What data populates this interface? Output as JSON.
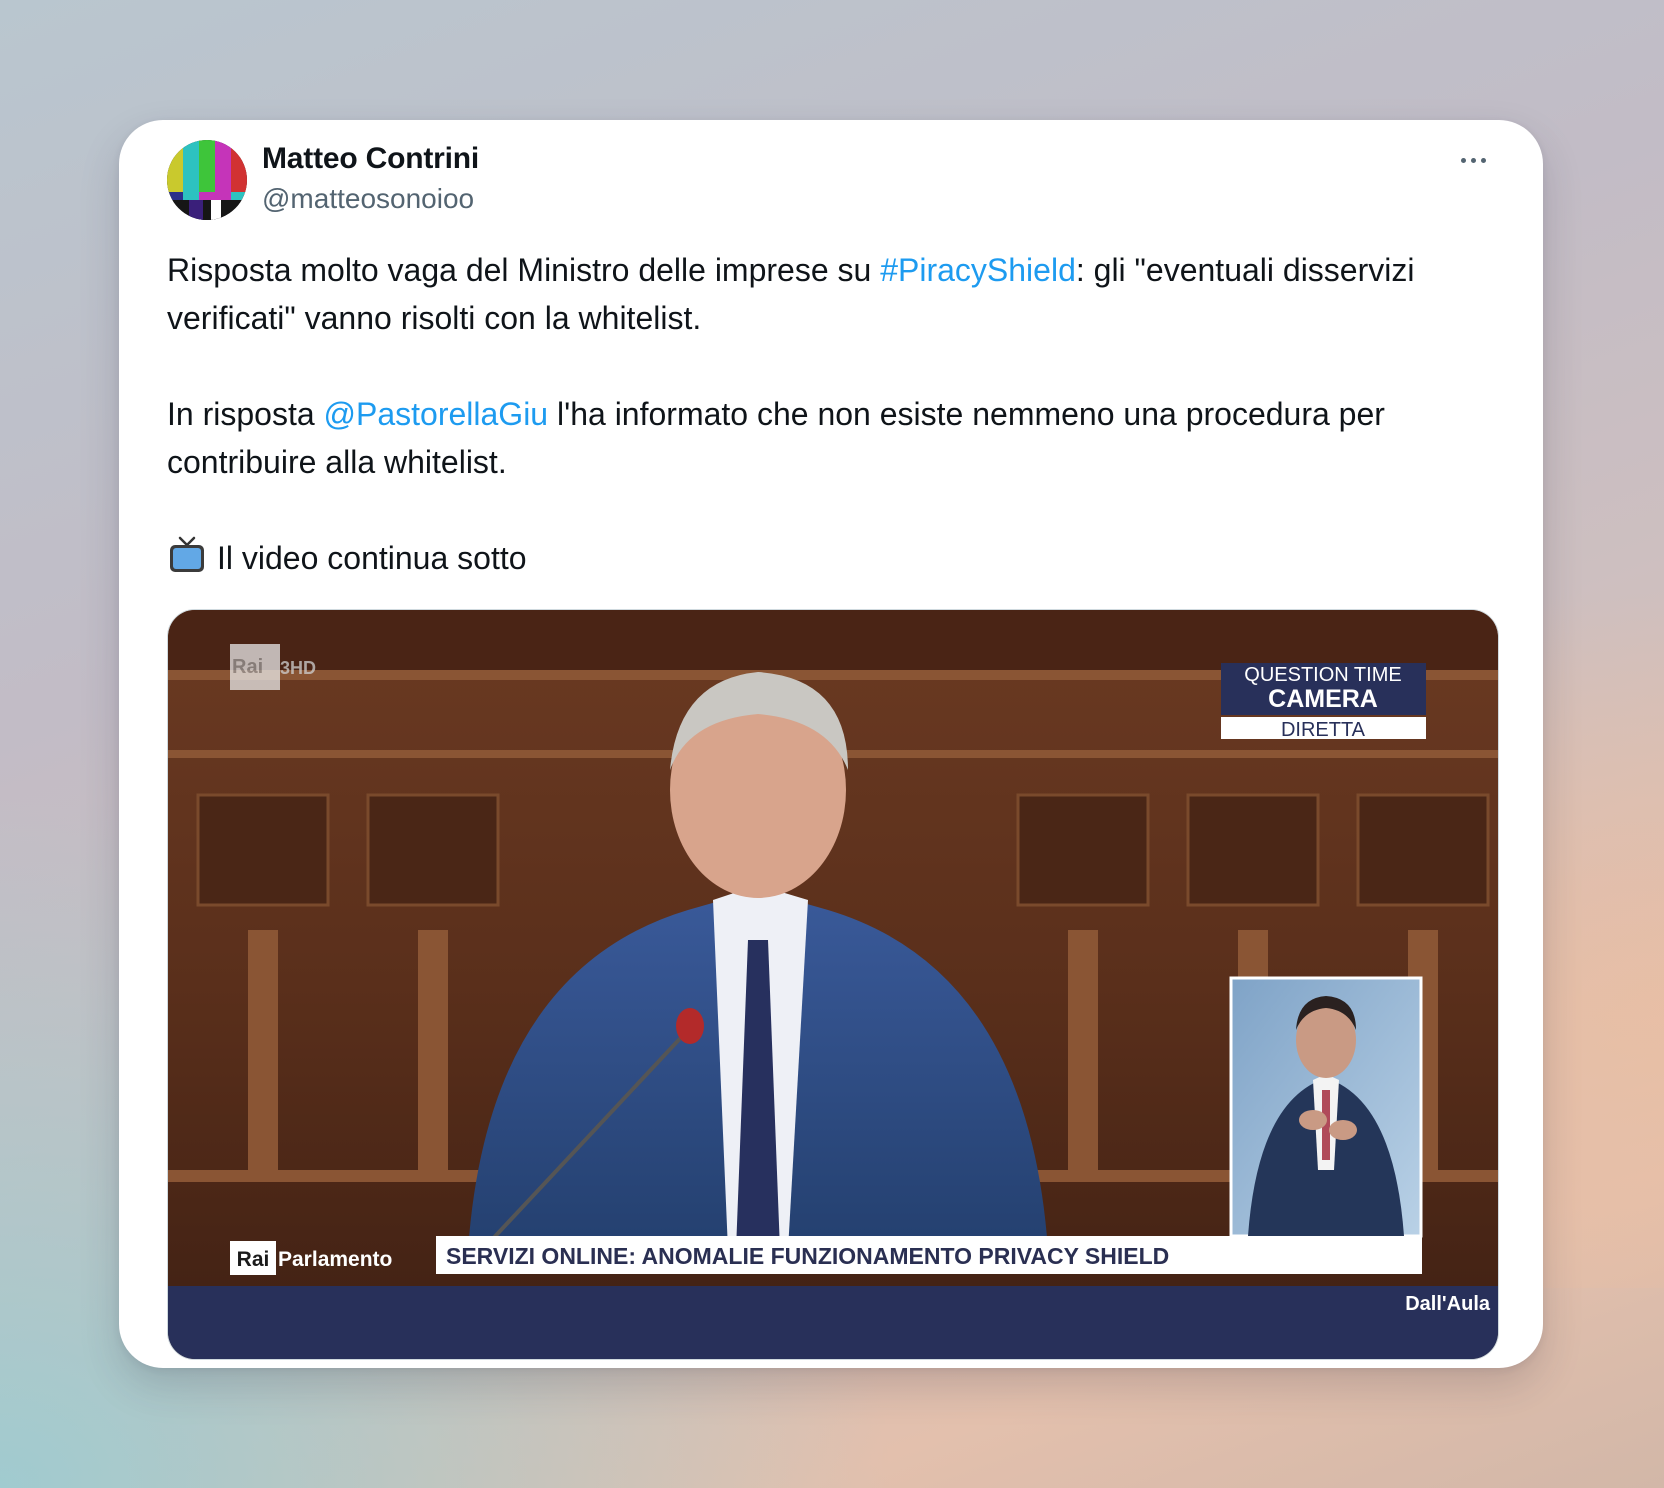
{
  "tweet": {
    "author_name": "Matteo Contrini",
    "author_handle": "@matteosonoioo",
    "paragraph1": {
      "before": "Risposta molto vaga del Ministro delle imprese su ",
      "hashtag": "#PiracyShield",
      "after": ": gli \"eventuali disservizi verificati\" vanno risolti con la whitelist."
    },
    "paragraph2": {
      "before": "In risposta ",
      "mention": "@PastorellaGiu",
      "after": " l'ha informato che non esiste nemmeno una procedura per contribuire alla whitelist."
    },
    "paragraph3": {
      "icon": "television-icon",
      "text": "Il video continua sotto"
    }
  },
  "video": {
    "channel_logo": "Rai 3 HD",
    "tag_top": "QUESTION TIME",
    "tag_main": "CAMERA",
    "tag_live": "DIRETTA",
    "lower_logo_rai": "Rai",
    "lower_logo_name": "Parlamento",
    "ticker": "SERVIZI ONLINE: ANOMALIE FUNZIONAMENTO PRIVACY SHIELD",
    "footer_tag": "Dall'Aula"
  },
  "colors": {
    "link": "#1d9bf0",
    "text": "#0f1419",
    "muted": "#536471",
    "video_band": "#28305a"
  }
}
